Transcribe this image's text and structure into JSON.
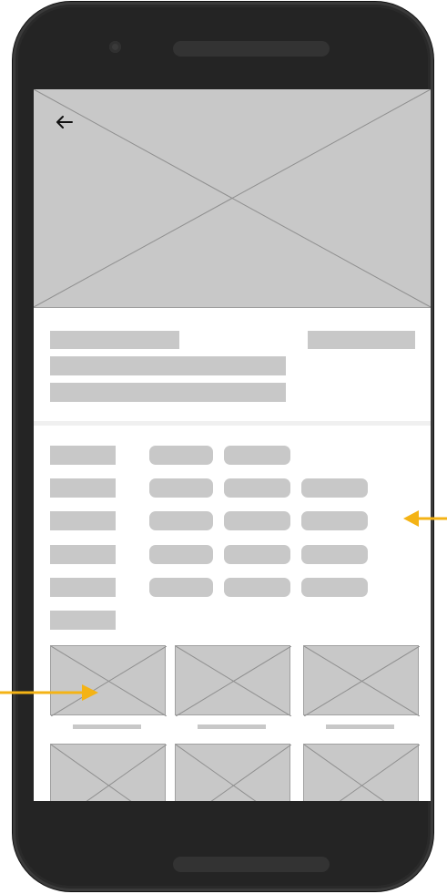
{
  "screen": {
    "back_icon": "arrow-left-icon",
    "hero": {
      "type": "image-placeholder"
    },
    "thumbnails": {
      "count": 6
    }
  },
  "annotations": {
    "color": "#f4b315",
    "arrows": [
      "annotation-arrow-right",
      "annotation-arrow-left"
    ]
  }
}
